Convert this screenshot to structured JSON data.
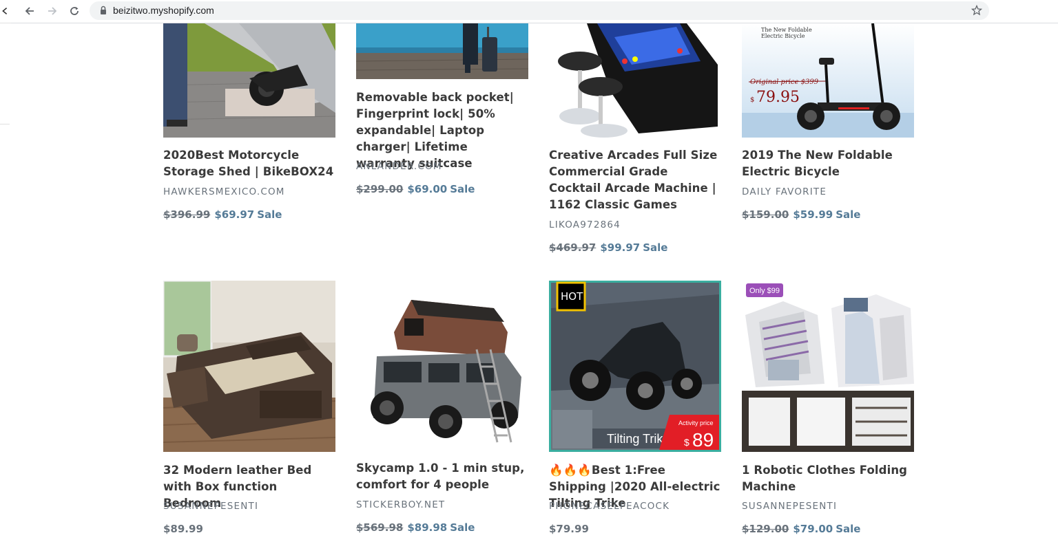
{
  "browser": {
    "url": "beizitwo.myshopify.com"
  },
  "products": [
    {
      "title": "2020Best Motorcycle Storage Shed | BikeBOX24",
      "vendor": "HAWKERSMEXICO.COM",
      "old_price": "$396.99",
      "price": "$69.97",
      "sale_label": "Sale"
    },
    {
      "title": "Removable back pocket| Fingerprint lock| 50% expandable| Laptop charger| Lifetime warranty suitcase",
      "vendor": "ANLANDER.COM",
      "old_price": "$299.00",
      "price": "$69.00",
      "sale_label": "Sale"
    },
    {
      "title": "Creative Arcades Full Size Commercial Grade Cocktail Arcade Machine | 1162 Classic Games",
      "vendor": "LIKOA972864",
      "old_price": "$469.97",
      "price": "$99.97",
      "sale_label": "Sale"
    },
    {
      "title": "2019 The New Foldable Electric Bicycle",
      "vendor": "DAILY FAVORITE",
      "old_price": "$159.00",
      "price": "$59.99",
      "sale_label": "Sale",
      "image_text": {
        "line1": "The New Foldable",
        "line2": "Electric Bicycle",
        "original": "Original price $399",
        "currency": "$",
        "amount": "79.95"
      }
    },
    {
      "title": "32 Modern leather Bed with Box function Bedroom",
      "vendor": "SUSANNEPESENTI",
      "price": "$89.99"
    },
    {
      "title": "Skycamp 1.0 - 1 min stup, comfort for 4 people",
      "vendor": "STICKERBOY.NET",
      "old_price": "$569.98",
      "price": "$89.98",
      "sale_label": "Sale"
    },
    {
      "title": "🔥🔥🔥Best 1:Free Shipping |2020 All-electric Tilting Trike",
      "vendor": "PHONECASELPEACOCK",
      "price": "$79.99",
      "image_text": {
        "badge": "HOT",
        "caption": "Tilting Trike",
        "activity": "Activity price",
        "currency": "$",
        "amount": "89"
      }
    },
    {
      "title": "1 Robotic Clothes Folding Machine",
      "vendor": "SUSANNEPESENTI",
      "old_price": "$129.00",
      "price": "$79.00",
      "sale_label": "Sale",
      "image_text": {
        "badge": "Only $99"
      }
    }
  ],
  "icons": [
    "back-arrow-icon",
    "forward-arrow-icon",
    "reload-icon",
    "lock-icon",
    "star-icon"
  ],
  "colors": {
    "sale": "#557b97",
    "vendor": "#69727b",
    "title": "#3a3a3a"
  }
}
